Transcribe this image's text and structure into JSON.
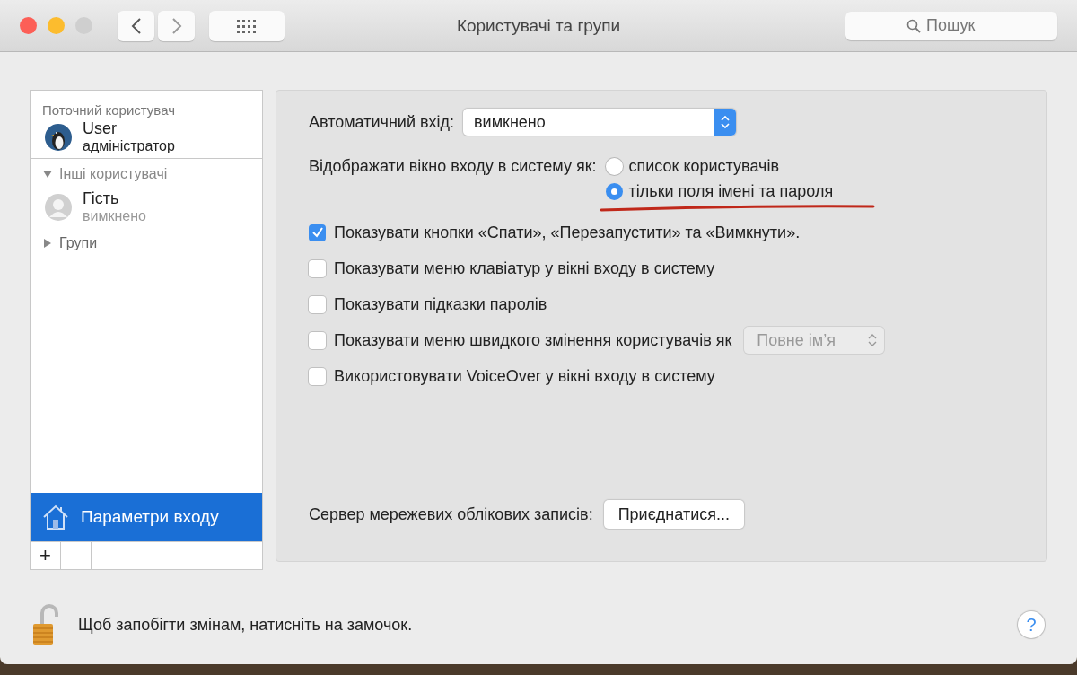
{
  "window": {
    "title": "Користувачі та групи",
    "search": {
      "placeholder": "Пошук"
    }
  },
  "sidebar": {
    "current_header": "Поточний користувач",
    "current_user": {
      "name": "User",
      "role": "адміністратор"
    },
    "others": {
      "label": "Інші користувачі",
      "expanded": true,
      "users": [
        {
          "name": "Гість",
          "status": "вимкнено"
        }
      ]
    },
    "groups": {
      "label": "Групи",
      "expanded": false
    },
    "login_options": {
      "label": "Параметри входу",
      "selected": true
    },
    "tools": [
      {
        "label": "+",
        "disabled": false
      },
      {
        "label": "—",
        "disabled": true
      }
    ]
  },
  "main": {
    "auto_login": {
      "label": "Автоматичний вхід:",
      "value": "вимкнено"
    },
    "display": {
      "label": "Відображати вікно входу в систему як:",
      "options": [
        {
          "label": "список користувачів",
          "selected": false
        },
        {
          "label": "тільки поля імені та пароля",
          "selected": true
        }
      ]
    },
    "checkboxes": [
      {
        "label": "Показувати кнопки «Спати», «Перезапустити» та «Вимкнути».",
        "checked": true
      },
      {
        "label": "Показувати меню клавіатур у вікні входу в систему",
        "checked": false
      },
      {
        "label": "Показувати підказки паролів",
        "checked": false
      },
      {
        "label": "Показувати меню швидкого змінення користувачів як",
        "checked": false,
        "dropdown": "Повне ім’я"
      },
      {
        "label": "Використовувати VoiceOver у вікні входу в систему",
        "checked": false
      }
    ],
    "server": {
      "label": "Сервер мережевих облікових записів:",
      "button": "Приєднатися..."
    }
  },
  "footer": {
    "text": "Щоб запобігти змінам, натисніть на замочок.",
    "help": "?"
  }
}
